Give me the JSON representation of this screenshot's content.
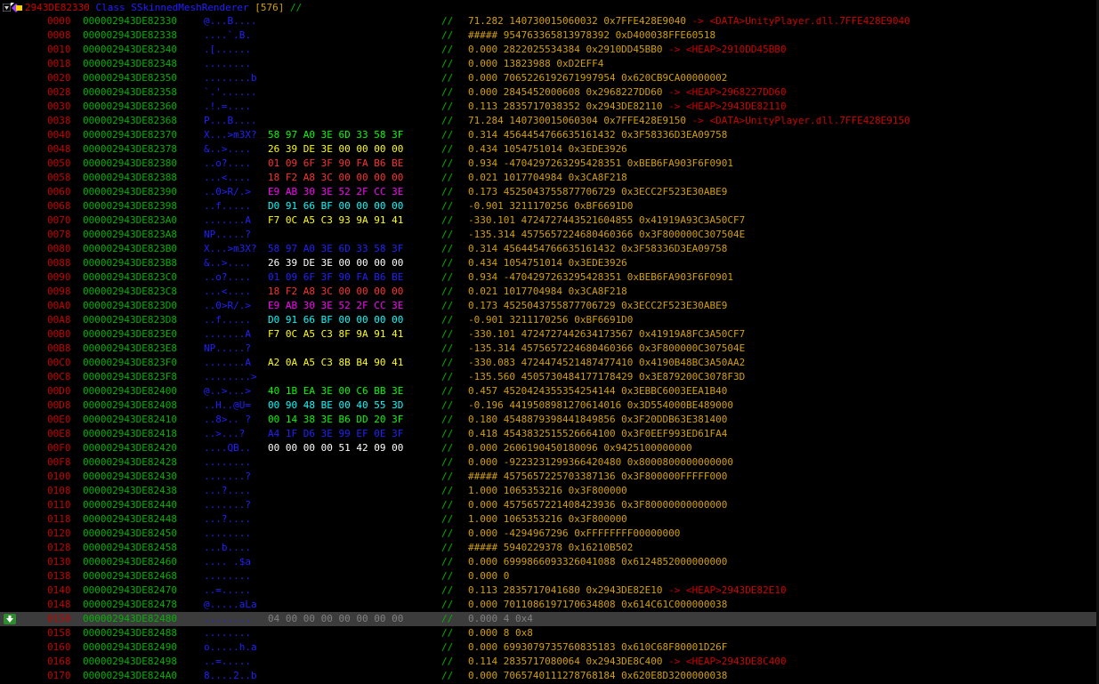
{
  "colors": {
    "offset": "#c80000",
    "address": "#00b400",
    "ascii": "#2020ff",
    "separator": "#00b400",
    "value": "#d4a000",
    "pointer": "#d00000",
    "hex_default": "#ffffff",
    "selected_text": "#808080"
  },
  "header": {
    "address": "2943DE82330",
    "class_label": "Class SSkinnedMeshRenderer",
    "size": "[576]",
    "comment": "//",
    "tree_icon": "expand-toggle-icon",
    "class_icon": "class-icon"
  },
  "rows": [
    {
      "offset": "0000",
      "address": "000002943DE82330",
      "ascii": "@...B....",
      "hex": [],
      "sep": "//",
      "value": "71.282 140730015060032 0x7FFE428E9040",
      "pointer": "-> <DATA>UnityPlayer.dll.7FFE428E9040"
    },
    {
      "offset": "0008",
      "address": "000002943DE82338",
      "ascii": "....`.B.",
      "hex": [],
      "sep": "//",
      "value": "##### 954763365813978392 0xD400038FFE60518",
      "pointer": ""
    },
    {
      "offset": "0010",
      "address": "000002943DE82340",
      "ascii": ".[......",
      "hex": [],
      "sep": "//",
      "value": "0.000 2822025534384 0x2910DD45BB0",
      "pointer": "-> <HEAP>2910DD45BB0"
    },
    {
      "offset": "0018",
      "address": "000002943DE82348",
      "ascii": "........",
      "hex": [],
      "sep": "//",
      "value": "0.000 13823988 0xD2EFF4",
      "pointer": ""
    },
    {
      "offset": "0020",
      "address": "000002943DE82350",
      "ascii": "........b",
      "hex": [],
      "sep": "//",
      "value": "0.000 7065226192671997954 0x620CB9CA00000002",
      "pointer": ""
    },
    {
      "offset": "0028",
      "address": "000002943DE82358",
      "ascii": "`.'......",
      "hex": [],
      "sep": "//",
      "value": "0.000 2845452000608 0x2968227DD60",
      "pointer": "-> <HEAP>2968227DD60"
    },
    {
      "offset": "0030",
      "address": "000002943DE82360",
      "ascii": ".!.=....",
      "hex": [],
      "sep": "//",
      "value": "0.113 2835717038352 0x2943DE82110",
      "pointer": "-> <HEAP>2943DE82110"
    },
    {
      "offset": "0038",
      "address": "000002943DE82368",
      "ascii": "P...B....",
      "hex": [],
      "sep": "//",
      "value": "71.284 140730015060304 0x7FFE428E9150",
      "pointer": "-> <DATA>UnityPlayer.dll.7FFE428E9150"
    },
    {
      "offset": "0040",
      "address": "000002943DE82370",
      "ascii": "X...>m3X?",
      "hex": [
        "58",
        "97",
        "A0",
        "3E",
        "6D",
        "33",
        "58",
        "3F"
      ],
      "hexColor": "#00ff00",
      "sep": "//",
      "value": "0.314 4564454766635161432 0x3F58336D3EA09758",
      "pointer": ""
    },
    {
      "offset": "0048",
      "address": "000002943DE82378",
      "ascii": "&..>....",
      "hex": [
        "26",
        "39",
        "DE",
        "3E",
        "00",
        "00",
        "00",
        "00"
      ],
      "hexColor": "#ffff00",
      "sep": "//",
      "value": "0.434 1054751014 0x3EDE3926",
      "pointer": ""
    },
    {
      "offset": "0050",
      "address": "000002943DE82380",
      "ascii": "..o?....",
      "hex": [
        "01",
        "09",
        "6F",
        "3F",
        "90",
        "FA",
        "B6",
        "BE"
      ],
      "hexColor": "#ff3030",
      "sep": "//",
      "value": "0.934 -4704297263295428351 0xBEB6FA903F6F0901",
      "pointer": ""
    },
    {
      "offset": "0058",
      "address": "000002943DE82388",
      "ascii": "...<....",
      "hex": [
        "18",
        "F2",
        "A8",
        "3C",
        "00",
        "00",
        "00",
        "00"
      ],
      "hexColor": "#ff3030",
      "sep": "//",
      "value": "0.021 1017704984 0x3CA8F218",
      "pointer": ""
    },
    {
      "offset": "0060",
      "address": "000002943DE82390",
      "ascii": "..0>R/.>",
      "hex": [
        "E9",
        "AB",
        "30",
        "3E",
        "52",
        "2F",
        "CC",
        "3E"
      ],
      "hexColor": "#ff00ff",
      "sep": "//",
      "value": "0.173 4525043755877706729 0x3ECC2F523E30ABE9",
      "pointer": ""
    },
    {
      "offset": "0068",
      "address": "000002943DE82398",
      "ascii": "..f.....",
      "hex": [
        "D0",
        "91",
        "66",
        "BF",
        "00",
        "00",
        "00",
        "00"
      ],
      "hexColor": "#00ffff",
      "sep": "//",
      "value": "-0.901 3211170256 0xBF6691D0",
      "pointer": ""
    },
    {
      "offset": "0070",
      "address": "000002943DE823A0",
      "ascii": ".......A",
      "hex": [
        "F7",
        "0C",
        "A5",
        "C3",
        "93",
        "9A",
        "91",
        "41"
      ],
      "hexColor": "#ffff00",
      "sep": "//",
      "value": "-330.101 4724727443521604855 0x41919A93C3A50CF7",
      "pointer": ""
    },
    {
      "offset": "0078",
      "address": "000002943DE823A8",
      "ascii": "NP.....?",
      "hex": [],
      "sep": "//",
      "value": "-135.314 4575657224680460366 0x3F800000C307504E",
      "pointer": ""
    },
    {
      "offset": "0080",
      "address": "000002943DE823B0",
      "ascii": "X...>m3X?",
      "hex": [
        "58",
        "97",
        "A0",
        "3E",
        "6D",
        "33",
        "58",
        "3F"
      ],
      "hexColor": "#2020ff",
      "sep": "//",
      "value": "0.314 4564454766635161432 0x3F58336D3EA09758",
      "pointer": ""
    },
    {
      "offset": "0088",
      "address": "000002943DE823B8",
      "ascii": "&..>....",
      "hex": [
        "26",
        "39",
        "DE",
        "3E",
        "00",
        "00",
        "00",
        "00"
      ],
      "hexColor": "#ffffff",
      "sep": "//",
      "value": "0.434 1054751014 0x3EDE3926",
      "pointer": ""
    },
    {
      "offset": "0090",
      "address": "000002943DE823C0",
      "ascii": "..o?....",
      "hex": [
        "01",
        "09",
        "6F",
        "3F",
        "90",
        "FA",
        "B6",
        "BE"
      ],
      "hexColor": "#2020ff",
      "sep": "//",
      "value": "0.934 -4704297263295428351 0xBEB6FA903F6F0901",
      "pointer": ""
    },
    {
      "offset": "0098",
      "address": "000002943DE823C8",
      "ascii": "...<....",
      "hex": [
        "18",
        "F2",
        "A8",
        "3C",
        "00",
        "00",
        "00",
        "00"
      ],
      "hexColor": "#ff3030",
      "sep": "//",
      "value": "0.021 1017704984 0x3CA8F218",
      "pointer": ""
    },
    {
      "offset": "00A0",
      "address": "000002943DE823D0",
      "ascii": "..0>R/.>",
      "hex": [
        "E9",
        "AB",
        "30",
        "3E",
        "52",
        "2F",
        "CC",
        "3E"
      ],
      "hexColor": "#ff00ff",
      "sep": "//",
      "value": "0.173 4525043755877706729 0x3ECC2F523E30ABE9",
      "pointer": ""
    },
    {
      "offset": "00A8",
      "address": "000002943DE823D8",
      "ascii": "..f.....",
      "hex": [
        "D0",
        "91",
        "66",
        "BF",
        "00",
        "00",
        "00",
        "00"
      ],
      "hexColor": "#00ffff",
      "sep": "//",
      "value": "-0.901 3211170256 0xBF6691D0",
      "pointer": ""
    },
    {
      "offset": "00B0",
      "address": "000002943DE823E0",
      "ascii": ".......A",
      "hex": [
        "F7",
        "0C",
        "A5",
        "C3",
        "8F",
        "9A",
        "91",
        "41"
      ],
      "hexColor": "#ffff00",
      "sep": "//",
      "value": "-330.101 4724727442634173567 0x41919A8FC3A50CF7",
      "pointer": ""
    },
    {
      "offset": "00B8",
      "address": "000002943DE823E8",
      "ascii": "NP.....?",
      "hex": [],
      "sep": "//",
      "value": "-135.314 4575657224680460366 0x3F800000C307504E",
      "pointer": ""
    },
    {
      "offset": "00C0",
      "address": "000002943DE823F0",
      "ascii": ".......A",
      "hex": [
        "A2",
        "0A",
        "A5",
        "C3",
        "8B",
        "B4",
        "90",
        "41"
      ],
      "hexColor": "#ffff00",
      "sep": "//",
      "value": "-330.083 4724474521487477410 0x4190B48BC3A50AA2",
      "pointer": ""
    },
    {
      "offset": "00C8",
      "address": "000002943DE823F8",
      "ascii": "........>",
      "hex": [],
      "sep": "//",
      "value": "-135.560 4505730484177178429 0x3E879200C3078F3D",
      "pointer": ""
    },
    {
      "offset": "00D0",
      "address": "000002943DE82400",
      "ascii": "@..>...>",
      "hex": [
        "40",
        "1B",
        "EA",
        "3E",
        "00",
        "C6",
        "BB",
        "3E"
      ],
      "hexColor": "#00ff00",
      "sep": "//",
      "value": "0.457 4520424355354254144 0x3EBBC6003EEA1B40",
      "pointer": ""
    },
    {
      "offset": "00D8",
      "address": "000002943DE82408",
      "ascii": "..H..@U=",
      "hex": [
        "00",
        "90",
        "48",
        "BE",
        "00",
        "40",
        "55",
        "3D"
      ],
      "hexColor": "#00ffff",
      "sep": "//",
      "value": "-0.196 4419508981270614016 0x3D554000BE489000",
      "pointer": ""
    },
    {
      "offset": "00E0",
      "address": "000002943DE82410",
      "ascii": "..8>.. ?",
      "hex": [
        "00",
        "14",
        "38",
        "3E",
        "B6",
        "DD",
        "20",
        "3F"
      ],
      "hexColor": "#00ff00",
      "sep": "//",
      "value": "0.180 4548879398441849856 0x3F20DDB63E381400",
      "pointer": ""
    },
    {
      "offset": "00E8",
      "address": "000002943DE82418",
      "ascii": "..>...?",
      "hex": [
        "A4",
        "1F",
        "D6",
        "3E",
        "99",
        "EF",
        "0E",
        "3F"
      ],
      "hexColor": "#2020ff",
      "sep": "//",
      "value": "0.418 4543832515526664100 0x3F0EEF993ED61FA4",
      "pointer": ""
    },
    {
      "offset": "00F0",
      "address": "000002943DE82420",
      "ascii": "....QB..",
      "hex": [
        "00",
        "00",
        "00",
        "00",
        "51",
        "42",
        "09",
        "00"
      ],
      "hexColor": "#ffffff",
      "sep": "//",
      "value": "0.000 2606190450180096 0x9425100000000",
      "pointer": ""
    },
    {
      "offset": "00F8",
      "address": "000002943DE82428",
      "ascii": "........",
      "hex": [],
      "sep": "//",
      "value": "0.000 -9223231299366420480 0x8000800000000000",
      "pointer": ""
    },
    {
      "offset": "0100",
      "address": "000002943DE82430",
      "ascii": ".......?",
      "hex": [],
      "sep": "//",
      "value": "##### 4575657225703387136 0x3F800000FFFFF000",
      "pointer": ""
    },
    {
      "offset": "0108",
      "address": "000002943DE82438",
      "ascii": "...?....",
      "hex": [],
      "sep": "//",
      "value": "1.000 1065353216 0x3F800000",
      "pointer": ""
    },
    {
      "offset": "0110",
      "address": "000002943DE82440",
      "ascii": ".......?",
      "hex": [],
      "sep": "//",
      "value": "0.000 4575657221408423936 0x3F80000000000000",
      "pointer": ""
    },
    {
      "offset": "0118",
      "address": "000002943DE82448",
      "ascii": "...?....",
      "hex": [],
      "sep": "//",
      "value": "1.000 1065353216 0x3F800000",
      "pointer": ""
    },
    {
      "offset": "0120",
      "address": "000002943DE82450",
      "ascii": "........",
      "hex": [],
      "sep": "//",
      "value": "0.000 -4294967296 0xFFFFFFFF00000000",
      "pointer": ""
    },
    {
      "offset": "0128",
      "address": "000002943DE82458",
      "ascii": "...b....",
      "hex": [],
      "sep": "//",
      "value": "##### 5940229378 0x16210B502",
      "pointer": ""
    },
    {
      "offset": "0130",
      "address": "000002943DE82460",
      "ascii": ".... .$a",
      "hex": [],
      "sep": "//",
      "value": "0.000 6999866093326041088 0x6124852000000000",
      "pointer": ""
    },
    {
      "offset": "0138",
      "address": "000002943DE82468",
      "ascii": "........",
      "hex": [],
      "sep": "//",
      "value": "0.000 0",
      "pointer": ""
    },
    {
      "offset": "0140",
      "address": "000002943DE82470",
      "ascii": "..=.....",
      "hex": [],
      "sep": "//",
      "value": "0.113 2835717041680 0x2943DE82E10",
      "pointer": "-> <HEAP>2943DE82E10"
    },
    {
      "offset": "0148",
      "address": "000002943DE82478",
      "ascii": "@.....aLa",
      "hex": [],
      "sep": "//",
      "value": "0.000 7011086197170634808 0x614C61C000000038",
      "pointer": ""
    },
    {
      "offset": "0150",
      "address": "000002943DE82480",
      "ascii": "........",
      "hex": [
        "04",
        "00",
        "00",
        "00",
        "00",
        "00",
        "00",
        "00"
      ],
      "hexColor": "#808080",
      "sep": "//",
      "value": "0.000 4 0x4",
      "pointer": "",
      "selected": true
    },
    {
      "offset": "0158",
      "address": "000002943DE82488",
      "ascii": "........",
      "hex": [],
      "sep": "//",
      "value": "0.000 8 0x8",
      "pointer": ""
    },
    {
      "offset": "0160",
      "address": "000002943DE82490",
      "ascii": "o.....h.a",
      "hex": [],
      "sep": "//",
      "value": "0.000 6993079735760835183 0x610C68F80001D26F",
      "pointer": ""
    },
    {
      "offset": "0168",
      "address": "000002943DE82498",
      "ascii": "..=.....",
      "hex": [],
      "sep": "//",
      "value": "0.114 2835717080064 0x2943DE8C400",
      "pointer": "-> <HEAP>2943DE8C400"
    },
    {
      "offset": "0170",
      "address": "000002943DE824A0",
      "ascii": "8....2..b",
      "hex": [],
      "sep": "//",
      "value": "0.000 7065740111278768184 0x620E8D3200000038",
      "pointer": ""
    }
  ],
  "selected_marker_icon": "arrow-down-icon"
}
